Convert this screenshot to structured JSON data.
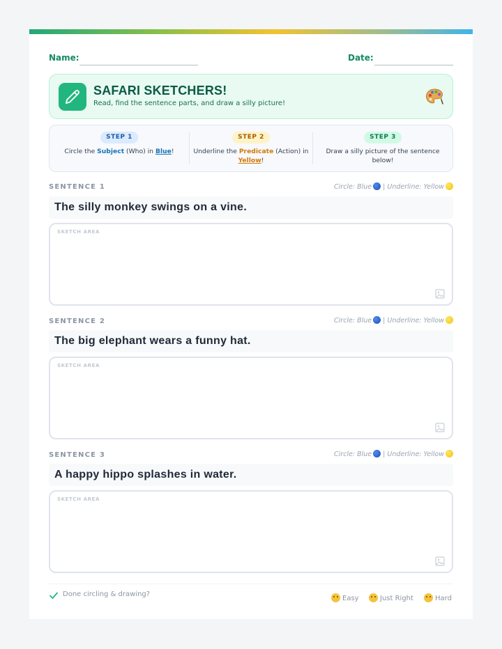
{
  "name_row": {
    "name_label": "Name:",
    "date_label": "Date:"
  },
  "header": {
    "title": "SAFARI SKETCHERS!",
    "subtitle": "Read, find the sentence parts, and draw a silly picture!",
    "icon": "pencil-icon",
    "decoration": "artist-palette-icon"
  },
  "steps": [
    {
      "badge": "STEP 1",
      "text_a": "Circle the ",
      "highlight_1": "Subject",
      "text_b": " (Who) in ",
      "highlight_2": "Blue",
      "text_c": "!",
      "badge_bg": "#dbeafe",
      "badge_color": "#1d5fa8"
    },
    {
      "badge": "STEP 2",
      "text_a": "Underline the ",
      "highlight_1": "Predicate",
      "text_b": " (Action) in ",
      "highlight_2": "Yellow",
      "text_c": "!",
      "badge_bg": "#fef3c7",
      "badge_color": "#a85d05"
    },
    {
      "badge": "STEP 3",
      "text": "Draw a silly picture of the sentence below!",
      "badge_bg": "#d1fae5",
      "badge_color": "#0f7a52"
    }
  ],
  "hint": {
    "circle": "Circle: Blue",
    "separator": " | ",
    "underline": "Underline: Yellow"
  },
  "sentences": [
    {
      "label": "SENTENCE 1",
      "text": "The silly monkey swings on a vine.",
      "sketch_label": "SKETCH AREA"
    },
    {
      "label": "SENTENCE 2",
      "text": "The big elephant wears a funny hat.",
      "sketch_label": "SKETCH AREA"
    },
    {
      "label": "SENTENCE 3",
      "text": "A happy hippo splashes in water.",
      "sketch_label": "SKETCH AREA"
    }
  ],
  "footer": {
    "done_text": "Done circling & drawing?",
    "ratings": [
      "Easy",
      "Just Right",
      "Hard"
    ]
  },
  "colors": {
    "brand_green": "#148a63",
    "accent_blue": "#1a73b8",
    "accent_orange": "#d17a06"
  }
}
